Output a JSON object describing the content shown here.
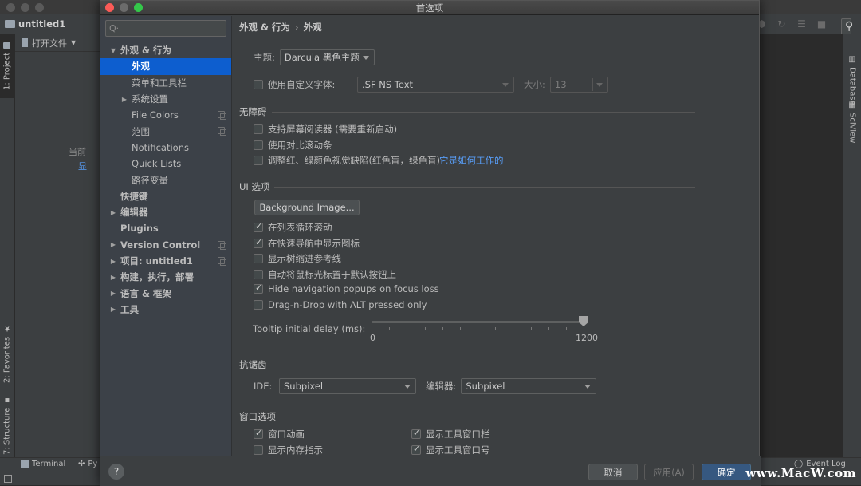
{
  "ide": {
    "project_name": "untitled1",
    "open_file_label": "打开文件",
    "left_tabs": [
      "1: Project",
      "2: Favorites",
      "7: Structure"
    ],
    "right_tabs": [
      "Database",
      "SciView"
    ],
    "empty_hint": "当前",
    "empty_link": "显",
    "bottom_tabs": [
      "Terminal",
      "Py"
    ],
    "event_log": "Event Log",
    "watermark": "www.MacW.com"
  },
  "dialog": {
    "title": "首选项",
    "search_placeholder": "Q·",
    "sidebar": [
      {
        "label": "外观 & 行为",
        "level": 0,
        "arrow": "down",
        "bold": true
      },
      {
        "label": "外观",
        "level": 1,
        "selected": true
      },
      {
        "label": "菜单和工具栏",
        "level": 1
      },
      {
        "label": "系统设置",
        "level": 1,
        "arrow": "right"
      },
      {
        "label": "File Colors",
        "level": 1,
        "copy": true
      },
      {
        "label": "范围",
        "level": 1,
        "copy": true
      },
      {
        "label": "Notifications",
        "level": 1
      },
      {
        "label": "Quick Lists",
        "level": 1
      },
      {
        "label": "路径变量",
        "level": 1
      },
      {
        "label": "快捷键",
        "level": 0,
        "bold": true
      },
      {
        "label": "编辑器",
        "level": 0,
        "arrow": "right",
        "bold": true
      },
      {
        "label": "Plugins",
        "level": 0,
        "bold": true
      },
      {
        "label": "Version Control",
        "level": 0,
        "arrow": "right",
        "bold": true,
        "copy": true
      },
      {
        "label": "项目: untitled1",
        "level": 0,
        "arrow": "right",
        "bold": true,
        "copy": true
      },
      {
        "label": "构建，执行，部署",
        "level": 0,
        "arrow": "right",
        "bold": true
      },
      {
        "label": "语言 & 框架",
        "level": 0,
        "arrow": "right",
        "bold": true
      },
      {
        "label": "工具",
        "level": 0,
        "arrow": "right",
        "bold": true
      }
    ],
    "breadcrumb": [
      "外观 & 行为",
      "外观"
    ],
    "theme": {
      "label": "主题:",
      "value": "Darcula 黑色主题"
    },
    "custom_font": {
      "label": "使用自定义字体:",
      "checked": false,
      "font": ".SF NS Text",
      "size_label": "大小:",
      "size": "13"
    },
    "accessibility": {
      "title": "无障碍",
      "options": [
        {
          "label": "支持屏幕阅读器 (需要重新启动)",
          "checked": false
        },
        {
          "label": "使用对比滚动条",
          "checked": false
        },
        {
          "label": "调整红、绿颜色视觉缺陷(红色盲，绿色盲)",
          "checked": false
        }
      ],
      "link": "它是如何工作的"
    },
    "ui_options": {
      "title": "UI 选项",
      "bg_button": "Background Image...",
      "options": [
        {
          "label": "在列表循环滚动",
          "checked": true
        },
        {
          "label": "在快速导航中显示图标",
          "checked": true
        },
        {
          "label": "显示树缩进参考线",
          "checked": false
        },
        {
          "label": "自动将鼠标光标置于默认按钮上",
          "checked": false
        },
        {
          "label": "Hide navigation popups on focus loss",
          "checked": true
        },
        {
          "label": "Drag-n-Drop with ALT pressed only",
          "checked": false
        }
      ],
      "tooltip_label": "Tooltip initial delay (ms):",
      "tooltip_min": "0",
      "tooltip_max": "1200",
      "tooltip_value": 1200
    },
    "antialiasing": {
      "title": "抗锯齿",
      "ide_label": "IDE:",
      "ide_value": "Subpixel",
      "editor_label": "编辑器:",
      "editor_value": "Subpixel"
    },
    "window_options": {
      "title": "窗口选项",
      "options": [
        {
          "label": "窗口动画",
          "checked": true
        },
        {
          "label": "显示工具窗口栏",
          "checked": true
        },
        {
          "label": "显示内存指示",
          "checked": false
        },
        {
          "label": "显示工具窗口号",
          "checked": true
        }
      ]
    },
    "footer": {
      "help": "?",
      "cancel": "取消",
      "apply": "应用(A)",
      "ok": "确定"
    }
  }
}
